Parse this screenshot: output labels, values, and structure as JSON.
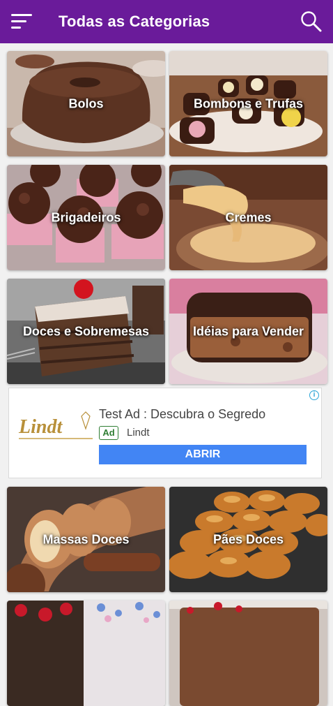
{
  "app": {
    "title": "Todas as Categorias",
    "menu_icon": "menu-icon",
    "search_icon": "search-icon",
    "brand_color": "#6a1b9a"
  },
  "categories": [
    {
      "label": "Bolos"
    },
    {
      "label": "Bombons e Trufas"
    },
    {
      "label": "Brigadeiros"
    },
    {
      "label": "Cremes"
    },
    {
      "label": "Doces e Sobremesas"
    },
    {
      "label": "Idéias para Vender"
    },
    {
      "label": "Massas Doces"
    },
    {
      "label": "Pães Doces"
    },
    {
      "label": ""
    },
    {
      "label": ""
    }
  ],
  "ad": {
    "headline": "Test Ad : Descubra o Segredo",
    "badge": "Ad",
    "advertiser": "Lindt",
    "cta": "ABRIR",
    "logo_text": "Lindt",
    "info_icon": "info-icon",
    "cta_color": "#4285f4"
  }
}
